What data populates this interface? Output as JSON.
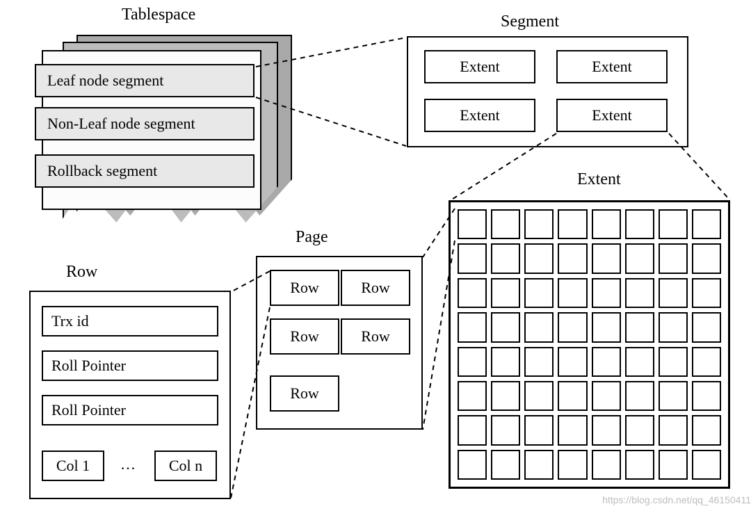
{
  "labels": {
    "tablespace": "Tablespace",
    "segment": "Segment",
    "extent": "Extent",
    "page": "Page",
    "row": "Row"
  },
  "tablespace": {
    "segments": [
      "Leaf node segment",
      "Non-Leaf node segment",
      "Rollback segment"
    ]
  },
  "segment": {
    "extents": [
      "Extent",
      "Extent",
      "Extent",
      "Extent"
    ]
  },
  "page": {
    "rows": [
      "Row",
      "Row",
      "Row",
      "Row",
      "Row"
    ]
  },
  "row": {
    "fields": [
      "Trx id",
      "Roll Pointer",
      "Roll Pointer"
    ],
    "col1": "Col 1",
    "ellipsis": "…",
    "coln": "Col n"
  },
  "extent_grid": {
    "cols": 8,
    "rows": 8
  },
  "watermark": "https://blog.csdn.net/qq_46150411"
}
